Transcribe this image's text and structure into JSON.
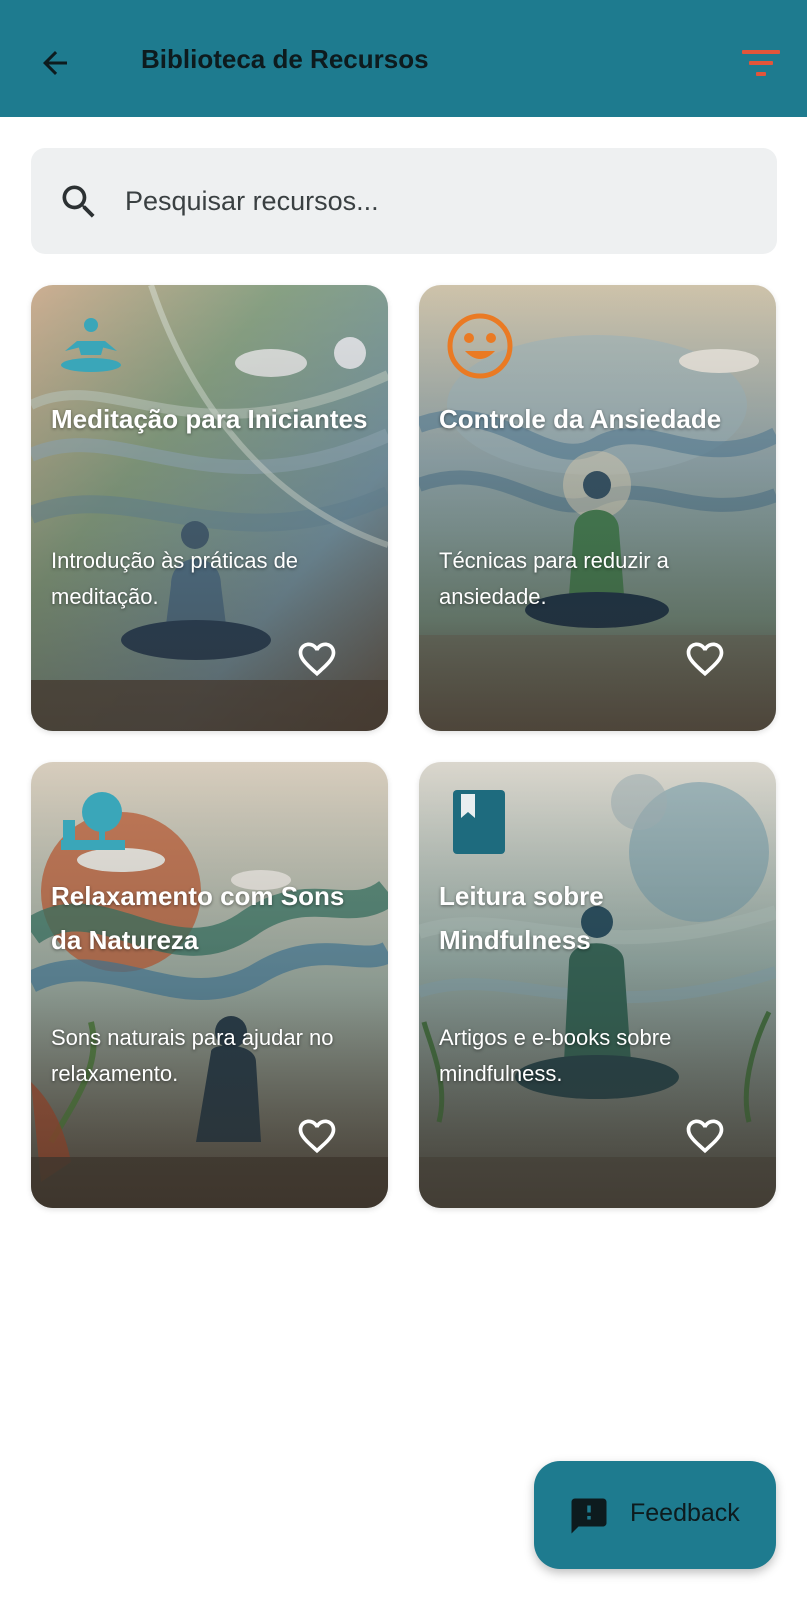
{
  "header": {
    "title": "Biblioteca de Recursos",
    "back_icon": "arrow-back-icon",
    "filter_icon": "filter-icon",
    "filter_color": "#e2553a"
  },
  "search": {
    "placeholder": "Pesquisar recursos...",
    "value": "",
    "icon": "search-icon"
  },
  "resources": [
    {
      "title": "Meditação para Iniciantes",
      "description": "Introdução às práticas de meditação.",
      "icon": "meditation-person-icon",
      "favorite": false
    },
    {
      "title": "Controle da Ansiedade",
      "description": "Técnicas para reduzir a ansiedade.",
      "icon": "smiley-face-icon",
      "favorite": false
    },
    {
      "title": "Relaxamento com Sons da Natureza",
      "description": "Sons naturais para ajudar no relaxamento.",
      "icon": "nature-tree-icon",
      "favorite": false
    },
    {
      "title": "Leitura sobre Mindfulness",
      "description": "Artigos e e-books sobre mindfulness.",
      "icon": "book-icon",
      "favorite": false
    }
  ],
  "fab": {
    "label": "Feedback",
    "icon": "feedback-icon"
  },
  "colors": {
    "primary": "#1e7b8f",
    "search_bg": "#eef0f1",
    "accent_orange": "#ea7a23"
  }
}
